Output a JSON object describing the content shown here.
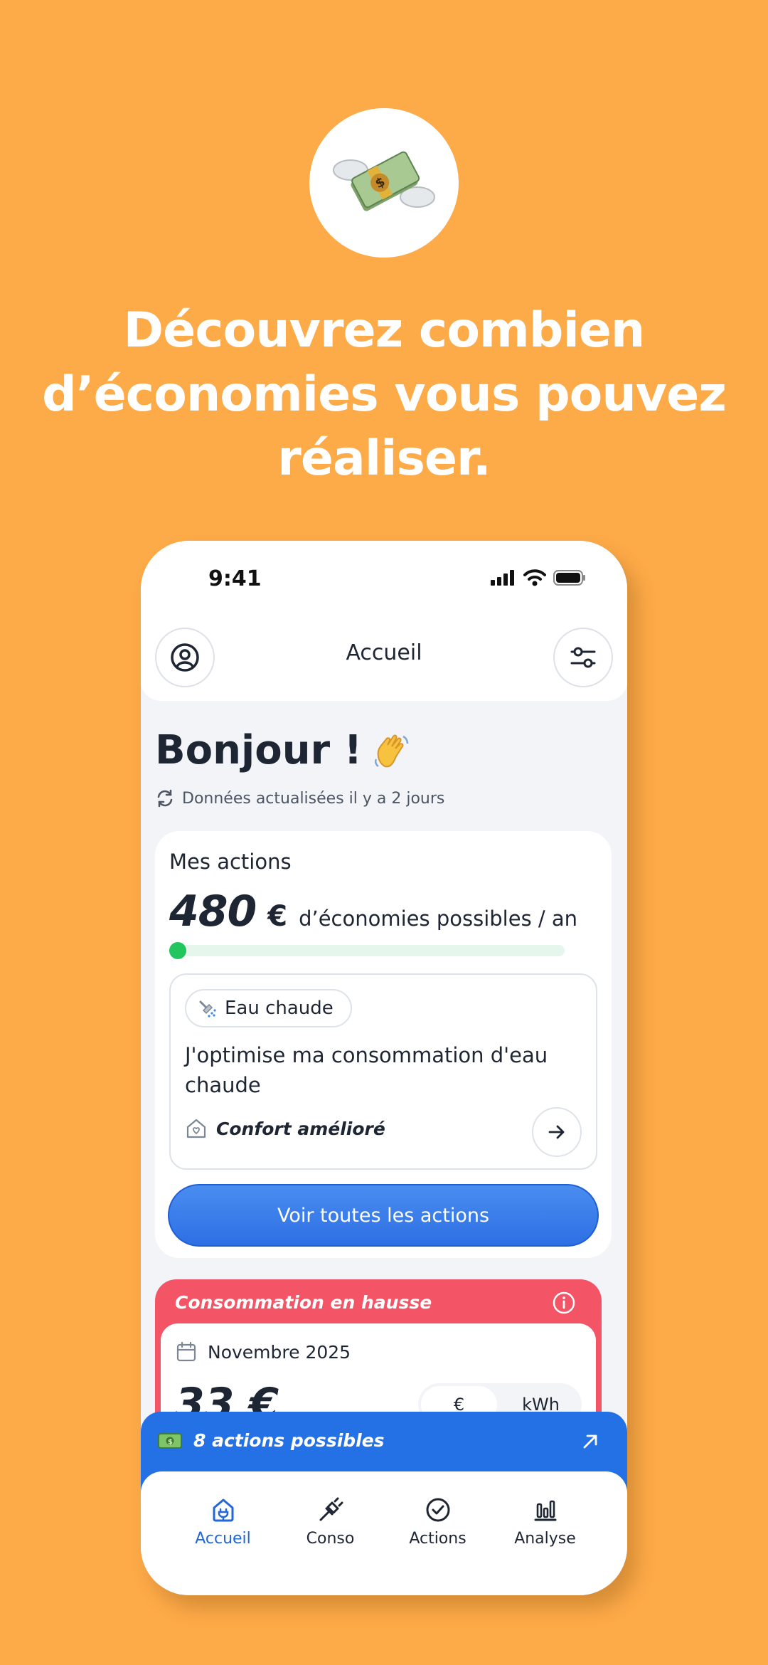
{
  "promo": {
    "badge_icon": "money-with-wings-icon",
    "headline": "Découvrez combien d’économies vous pouvez réaliser."
  },
  "status_bar": {
    "time": "9:41",
    "icons": [
      "signal-icon",
      "wifi-icon",
      "battery-icon"
    ]
  },
  "header": {
    "title": "Accueil",
    "left_icon": "user-circle-icon",
    "right_icon": "sliders-icon"
  },
  "greeting": {
    "text": "Bonjour !",
    "emoji_icon": "waving-hand-icon",
    "updated_text": "Données actualisées il y a 2 jours"
  },
  "actions_card": {
    "title": "Mes actions",
    "amount": "480",
    "currency": "€",
    "amount_suffix": "d’économies possibles / an",
    "progress_fraction": 0.0,
    "action": {
      "tag": "Eau chaude",
      "title": "J'optimise ma consommation d'eau chaude",
      "benefit": "Confort amélioré"
    },
    "button_label": "Voir toutes les actions"
  },
  "conso_card": {
    "title": "Consommation en hausse",
    "month": "Novembre 2025",
    "amount": "33 €",
    "unit_options": [
      "€",
      "kWh"
    ],
    "selected_unit": "€"
  },
  "banner": {
    "text": "8 actions possibles",
    "icon": "money-icon"
  },
  "nav": {
    "items": [
      {
        "label": "Accueil",
        "icon": "home-plug-icon"
      },
      {
        "label": "Conso",
        "icon": "plug-icon"
      },
      {
        "label": "Actions",
        "icon": "check-circle-icon"
      },
      {
        "label": "Analyse",
        "icon": "bar-chart-icon"
      }
    ],
    "active": "Accueil"
  },
  "colors": {
    "background": "#FDAA48",
    "primary": "#2471E6",
    "alert": "#F35567",
    "progress": "#22C55E"
  }
}
